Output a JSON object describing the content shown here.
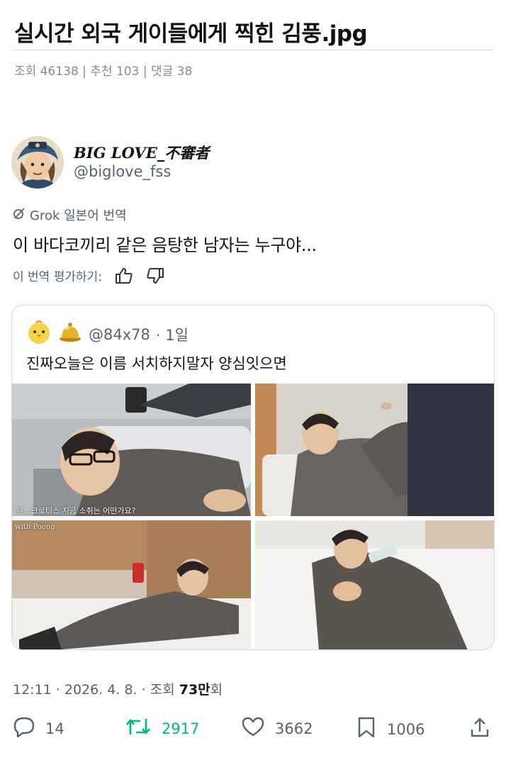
{
  "post": {
    "title": "실시간 외국 게이들에게 찍힌 김풍.jpg",
    "meta": "조회 46138 | 추천 103 | 댓글 38"
  },
  "tweet": {
    "display_name": "BIG LOVE_不審者",
    "handle": "@biglove_fss",
    "grok_label": "Grok 일본어 번역",
    "text": "이 바다코끼리 같은 음탕한 남자는 누구야...",
    "rate_label": "이 번역 평가하기:",
    "timestamp": "12:11 · 2026. 4. 8. · 조회 ",
    "views_bold": "73만",
    "views_suffix": "회"
  },
  "quote": {
    "handle": "@84x78",
    "time": "· 1일",
    "text": "진짜오늘은 이름 서치하지말자 양심잇으면",
    "images": [
      {
        "caption": "큐...크로티스 지금 소취는 어떤가요?"
      },
      {
        "caption": ""
      },
      {
        "caption": "with Poong"
      },
      {
        "caption": ""
      }
    ]
  },
  "actions": {
    "replies": "14",
    "retweets": "2917",
    "likes": "3662",
    "bookmarks": "1006"
  },
  "icons": {
    "grok": "grok-icon",
    "thumbs_up": "thumbs-up-icon",
    "thumbs_down": "thumbs-down-icon",
    "reply": "reply-icon",
    "retweet": "retweet-icon",
    "like": "heart-icon",
    "bookmark": "bookmark-icon",
    "share": "share-icon"
  },
  "colors": {
    "retweet_green": "#00ba7c",
    "secondary_text": "#536471",
    "border": "#cfd9de"
  }
}
